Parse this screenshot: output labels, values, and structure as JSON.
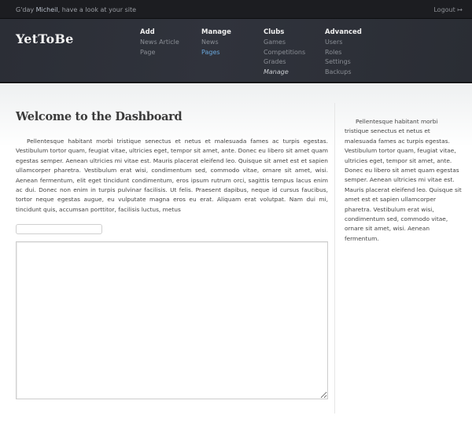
{
  "topbar": {
    "greeting_prefix": "G'day ",
    "user_name": "Micheil",
    "greeting_suffix": ", have a look at your site",
    "logout_label": "Logout",
    "logout_icon": "↦"
  },
  "header": {
    "logo": "YetToBe",
    "nav": [
      {
        "heading": "Add",
        "items": [
          {
            "label": "News Article"
          },
          {
            "label": "Page"
          }
        ]
      },
      {
        "heading": "Manage",
        "items": [
          {
            "label": "News"
          },
          {
            "label": "Pages",
            "active": true
          }
        ]
      },
      {
        "heading": "Clubs",
        "items": [
          {
            "label": "Games"
          },
          {
            "label": "Competitions"
          },
          {
            "label": "Grades"
          },
          {
            "label": "Manage",
            "italic": true
          }
        ]
      },
      {
        "heading": "Advanced",
        "items": [
          {
            "label": "Users"
          },
          {
            "label": "Roles"
          },
          {
            "label": "Settings"
          },
          {
            "label": "Backups"
          }
        ]
      }
    ]
  },
  "main": {
    "title": "Welcome to the Dashboard",
    "paragraph": "Pellentesque habitant morbi tristique senectus et netus et malesuada fames ac turpis egestas. Vestibulum tortor quam, feugiat vitae, ultricies eget, tempor sit amet, ante. Donec eu libero sit amet quam egestas semper. Aenean ultricies mi vitae est. Mauris placerat eleifend leo. Quisque sit amet est et sapien ullamcorper pharetra. Vestibulum erat wisi, condimentum sed, commodo vitae, ornare sit amet, wisi. Aenean fermentum, elit eget tincidunt condimentum, eros ipsum rutrum orci, sagittis tempus lacus enim ac dui. Donec non enim in turpis pulvinar facilisis. Ut felis. Praesent dapibus, neque id cursus faucibus, tortor neque egestas augue, eu vulputate magna eros eu erat. Aliquam erat volutpat. Nam dui mi, tincidunt quis, accumsan porttitor, facilisis luctus, metus",
    "input_value": "",
    "textarea_value": ""
  },
  "sidebar": {
    "paragraph": "Pellentesque habitant morbi tristique senectus et netus et malesuada fames ac turpis egestas. Vestibulum tortor quam, feugiat vitae, ultricies eget, tempor sit amet, ante. Donec eu libero sit amet quam egestas semper. Aenean ultricies mi vitae est. Mauris placerat eleifend leo. Quisque sit amet est et sapien ullamcorper pharetra. Vestibulum erat wisi, condimentum sed, commodo vitae, ornare sit amet, wisi. Aenean fermentum."
  },
  "colors": {
    "topbar_bg": "#1c1d21",
    "header_bg": "#2e3139",
    "active_link": "#6aa7dc"
  }
}
